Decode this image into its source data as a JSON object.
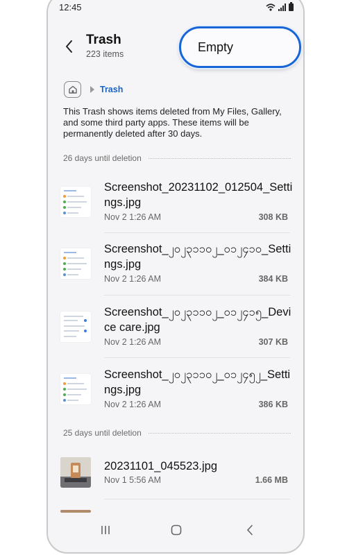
{
  "status": {
    "time": "12:45"
  },
  "header": {
    "title": "Trash",
    "subtitle": "223 items",
    "empty_label": "Empty"
  },
  "breadcrumb": {
    "current": "Trash"
  },
  "info_text": "This Trash shows items deleted from My Files, Gallery, and some third party apps. These items will be permanently deleted after 30 days.",
  "sections": [
    {
      "label": "26 days until deletion",
      "files": [
        {
          "name": "Screenshot_20231102_012504_Settings.jpg",
          "date": "Nov 2 1:26 AM",
          "size": "308 KB"
        },
        {
          "name": "Screenshot_၂၀၂၃၁၁၀၂_၀၁၂၄၁၀_Settings.jpg",
          "date": "Nov 2 1:26 AM",
          "size": "384 KB"
        },
        {
          "name": "Screenshot_၂၀၂၃၁၁၀၂_၀၁၂၄၁၅_Device care.jpg",
          "date": "Nov 2 1:26 AM",
          "size": "307 KB"
        },
        {
          "name": "Screenshot_၂၀၂၃၁၁၀၂_၀၁၂၄၅၂_Settings.jpg",
          "date": "Nov 2 1:26 AM",
          "size": "386 KB"
        }
      ]
    },
    {
      "label": "25 days until deletion",
      "files": [
        {
          "name": "20231101_045523.jpg",
          "date": "Nov 1 5:56 AM",
          "size": "1.66 MB"
        }
      ]
    }
  ],
  "colors": {
    "accent": "#1765d6",
    "background": "#f5f5f7"
  },
  "icons": {
    "back": "chevron-left-icon",
    "home": "home-folder-icon",
    "wifi": "wifi-icon",
    "signal": "signal-icon",
    "battery": "battery-icon"
  }
}
